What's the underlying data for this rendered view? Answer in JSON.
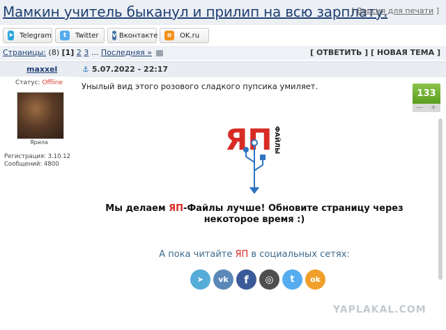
{
  "header": {
    "title": "Мамкин учитель быканул и прилип на всю зарплату.",
    "print_link": "Версия для печати",
    "print_bracket_open": "[",
    "print_bracket_close": "]"
  },
  "share": [
    {
      "label": "Telegram",
      "icon": "telegram-icon",
      "color": "#2ca5e0"
    },
    {
      "label": "Twitter",
      "icon": "twitter-icon",
      "color": "#55acee"
    },
    {
      "label": "Вконтакте",
      "icon": "vk-icon",
      "color": "#4a76a8"
    },
    {
      "label": "OK.ru",
      "icon": "ok-icon",
      "color": "#f2911c"
    }
  ],
  "pagination": {
    "label": "Страницы:",
    "count": "(8)",
    "current": "[1]",
    "pages": [
      "2",
      "3"
    ],
    "ellipsis": "...",
    "last": "Последняя »"
  },
  "actions": {
    "reply": "[ ОТВЕТИТЬ ]",
    "new_topic": "[ НОВАЯ ТЕМА ]"
  },
  "post": {
    "author": "maxxel",
    "date": "5.07.2022 - 22:17",
    "status_label": "Статус:",
    "status_value": "Offline",
    "avatar_caption": "Ярила",
    "registration": "Регистрация: 3.10.12",
    "messages": "Сообщений: 4800",
    "text": "Унылый вид этого розового сладкого пупсика умиляет.",
    "rating": "133",
    "vote_minus": "—",
    "vote_plus": "+"
  },
  "embed": {
    "logo_ya": "ЯП",
    "logo_files": "ФАЙЛЫ",
    "notice_pre": "Мы делаем ",
    "notice_ya": "ЯП",
    "notice_post": "-Файлы лучше! Обновите страницу через некоторое время :)",
    "social_pre": "А пока читайте ",
    "social_ya": "ЯП",
    "social_post": " в социальных сетях:",
    "social_icons": [
      {
        "name": "telegram-icon",
        "color": "#55acd9",
        "glyph": "➤"
      },
      {
        "name": "vk-icon",
        "color": "#5b88b8",
        "glyph": "vk"
      },
      {
        "name": "facebook-icon",
        "color": "#3b5a99",
        "glyph": "f"
      },
      {
        "name": "instagram-icon",
        "color": "#4e4e4e",
        "glyph": "◎"
      },
      {
        "name": "twitter-icon",
        "color": "#55acee",
        "glyph": "t"
      },
      {
        "name": "odnoklassniki-icon",
        "color": "#f0a02a",
        "glyph": "ok"
      }
    ]
  },
  "watermark": "YAPLAKAL.COM"
}
